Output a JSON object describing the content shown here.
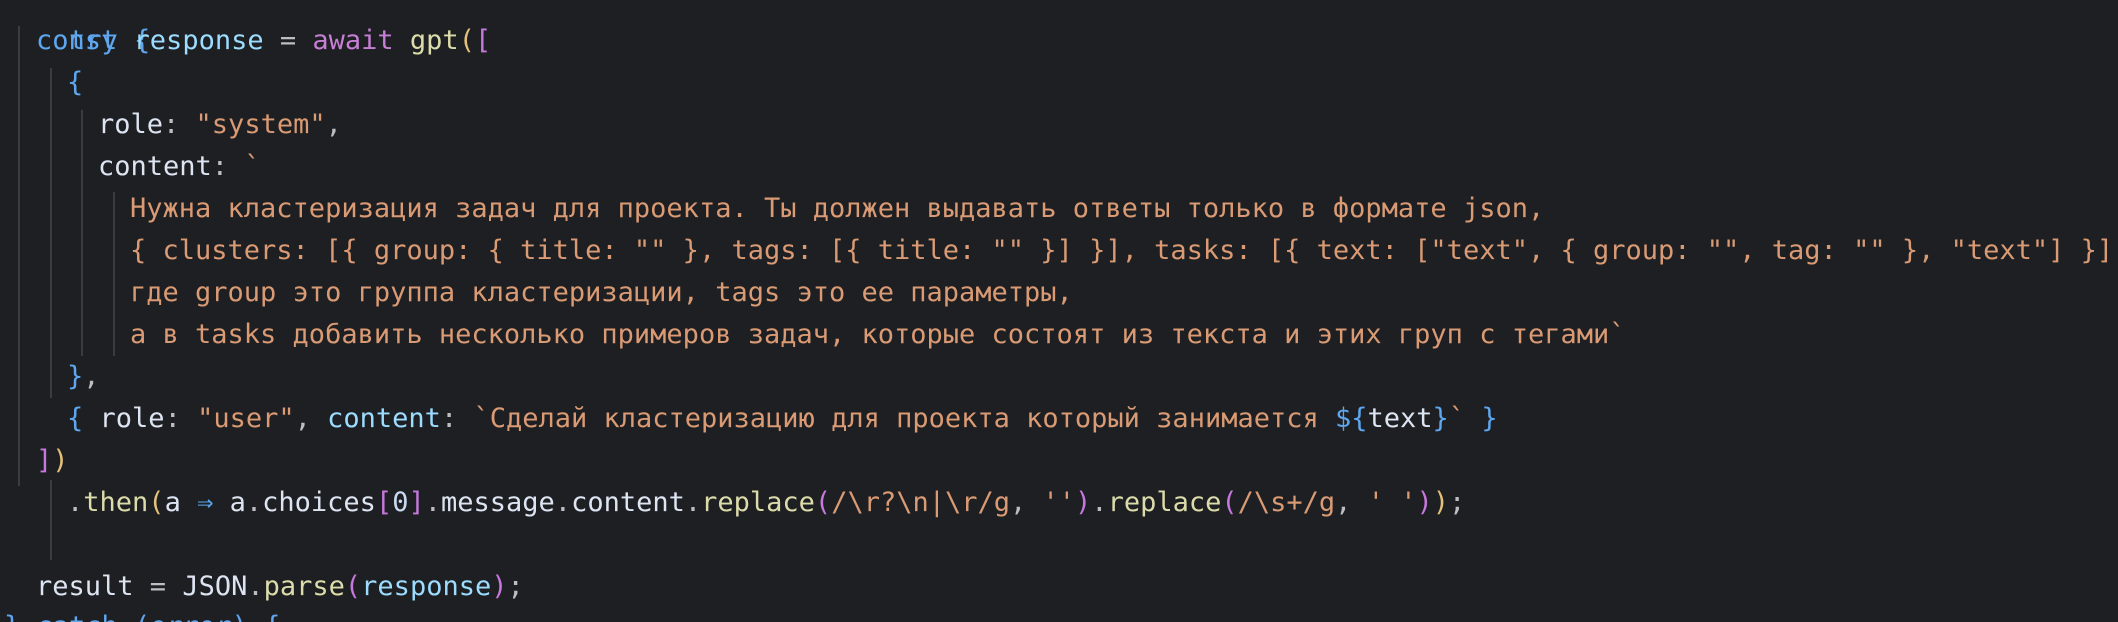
{
  "editor": {
    "language": "javascript",
    "theme_colors": {
      "background": "#1e1f22",
      "keyword": "#5ea7f0",
      "await": "#c57fd4",
      "function": "#dcdcaa",
      "string": "#d99a74",
      "property": "#dde4f2"
    },
    "code": {
      "line_try": "try {",
      "line_const": "const",
      "line_response": "response",
      "line_eq": " = ",
      "line_await": "await",
      "line_gpt": "gpt",
      "role_key": "role",
      "role_system": "\"system\"",
      "content_key": "content",
      "prompt_1": "Нужна кластеризация задач для проекта. Ты должен выдавать ответы только в формате json,",
      "prompt_2": "{ clusters: [{ group: { title: \"\" }, tags: [{ title: \"\" }] }], tasks: [{ text: [\"text\", { group: \"\", tag: \"\" }, \"text\"] }] },",
      "prompt_3": "где group это группа кластеризации, tags это ее параметры,",
      "prompt_4": "а в tasks добавить несколько примеров задач, которые состоят из текста и этих груп с тегами`",
      "role_user": "\"user\"",
      "user_content": "`Сделай кластеризацию для проекта который занимается ",
      "tpl_open": "${",
      "tpl_var": "text",
      "tpl_close": "}",
      "tpl_end": "`",
      "then": "then",
      "arrow_param": "a",
      "arrow": " ⇒ ",
      "chain_a": "a",
      "choices": "choices",
      "index": "0",
      "message": "message",
      "content": "content",
      "replace": "replace",
      "regex1": "/\\r?\\n|\\r/g",
      "empty_str": "''",
      "regex2": "/\\s+/g",
      "space_str": "' '",
      "result": "result",
      "json": "JSON",
      "parse": "parse",
      "catch_line": "} catch (error) {"
    }
  }
}
